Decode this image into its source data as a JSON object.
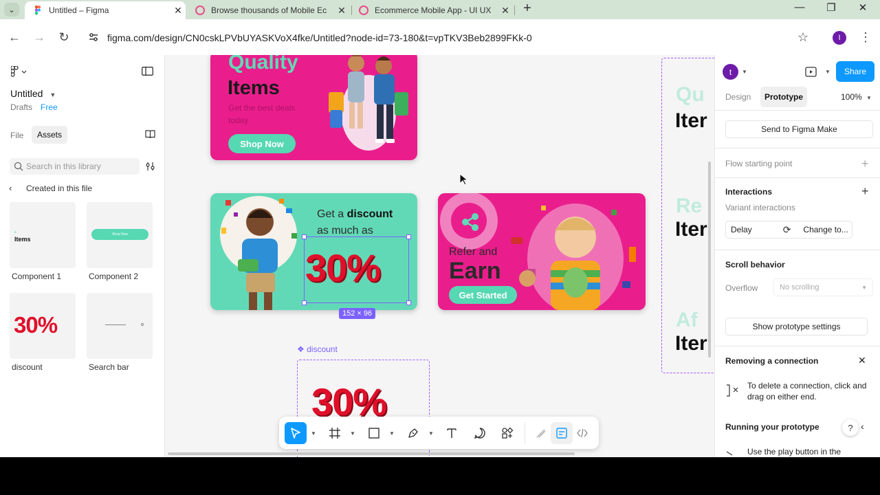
{
  "browser": {
    "tabs": [
      {
        "label": "Untitled – Figma",
        "active": true
      },
      {
        "label": "Browse thousands of Mobile Ec",
        "active": false
      },
      {
        "label": "Ecommerce Mobile App - UI UX",
        "active": false
      }
    ],
    "url": "figma.com/design/CN0cskLPVbUYASKVoX4fke/Untitled?node-id=73-180&t=vpTKV3Beb2899FKk-0",
    "profile_initial": "I"
  },
  "left_panel": {
    "file_title": "Untitled",
    "drafts": "Drafts",
    "plan": "Free",
    "tab_file": "File",
    "tab_assets": "Assets",
    "search_placeholder": "Search in this library",
    "back_label": "Created in this file",
    "assets": [
      {
        "name": "Component 1",
        "preview": "Items"
      },
      {
        "name": "Component 2",
        "preview": "Shop Now"
      },
      {
        "name": "discount",
        "preview": "30%"
      },
      {
        "name": "Search bar",
        "preview": ""
      }
    ]
  },
  "canvas": {
    "banner1": {
      "title_light": "Quality",
      "title_bold": "Items",
      "subtitle_1": "Get the best deals",
      "subtitle_2": "today",
      "button": "Shop Now"
    },
    "banner2": {
      "line1_prefix": "Get a",
      "line1_bold": "discount",
      "line2": "as much as",
      "big": "30%"
    },
    "banner3": {
      "line1": "Refer and",
      "line2": "Earn",
      "button": "Get Started"
    },
    "selection_size": "152 × 96",
    "component_label": "discount",
    "component_big": "30%",
    "right_frame_rows": [
      {
        "light": "Qu",
        "bold": "Iter"
      },
      {
        "light": "Re",
        "bold": "Iter"
      },
      {
        "light": "Af",
        "bold": "Iter"
      }
    ]
  },
  "right_panel": {
    "user_initial": "t",
    "share": "Share",
    "tab_design": "Design",
    "tab_prototype": "Prototype",
    "zoom": "100%",
    "send_to_make": "Send to Figma Make",
    "flow_starting_point": "Flow starting point",
    "interactions": "Interactions",
    "variant_interactions": "Variant interactions",
    "delay": "Delay",
    "change_to": "Change to...",
    "scroll_behavior": "Scroll behavior",
    "overflow": "Overflow",
    "overflow_value": "No scrolling",
    "show_settings": "Show prototype settings",
    "removing_title": "Removing a connection",
    "removing_text_1": "To delete a connection, click and",
    "removing_text_2": "drag on either end.",
    "running_title": "Running your prototype",
    "running_text": "Use the play button in the"
  },
  "colors": {
    "pink": "#e91e8c",
    "mint": "#62d9b6",
    "figma_blue": "#0d99ff",
    "selection": "#7b61ff",
    "discount_red": "#e0102a"
  }
}
